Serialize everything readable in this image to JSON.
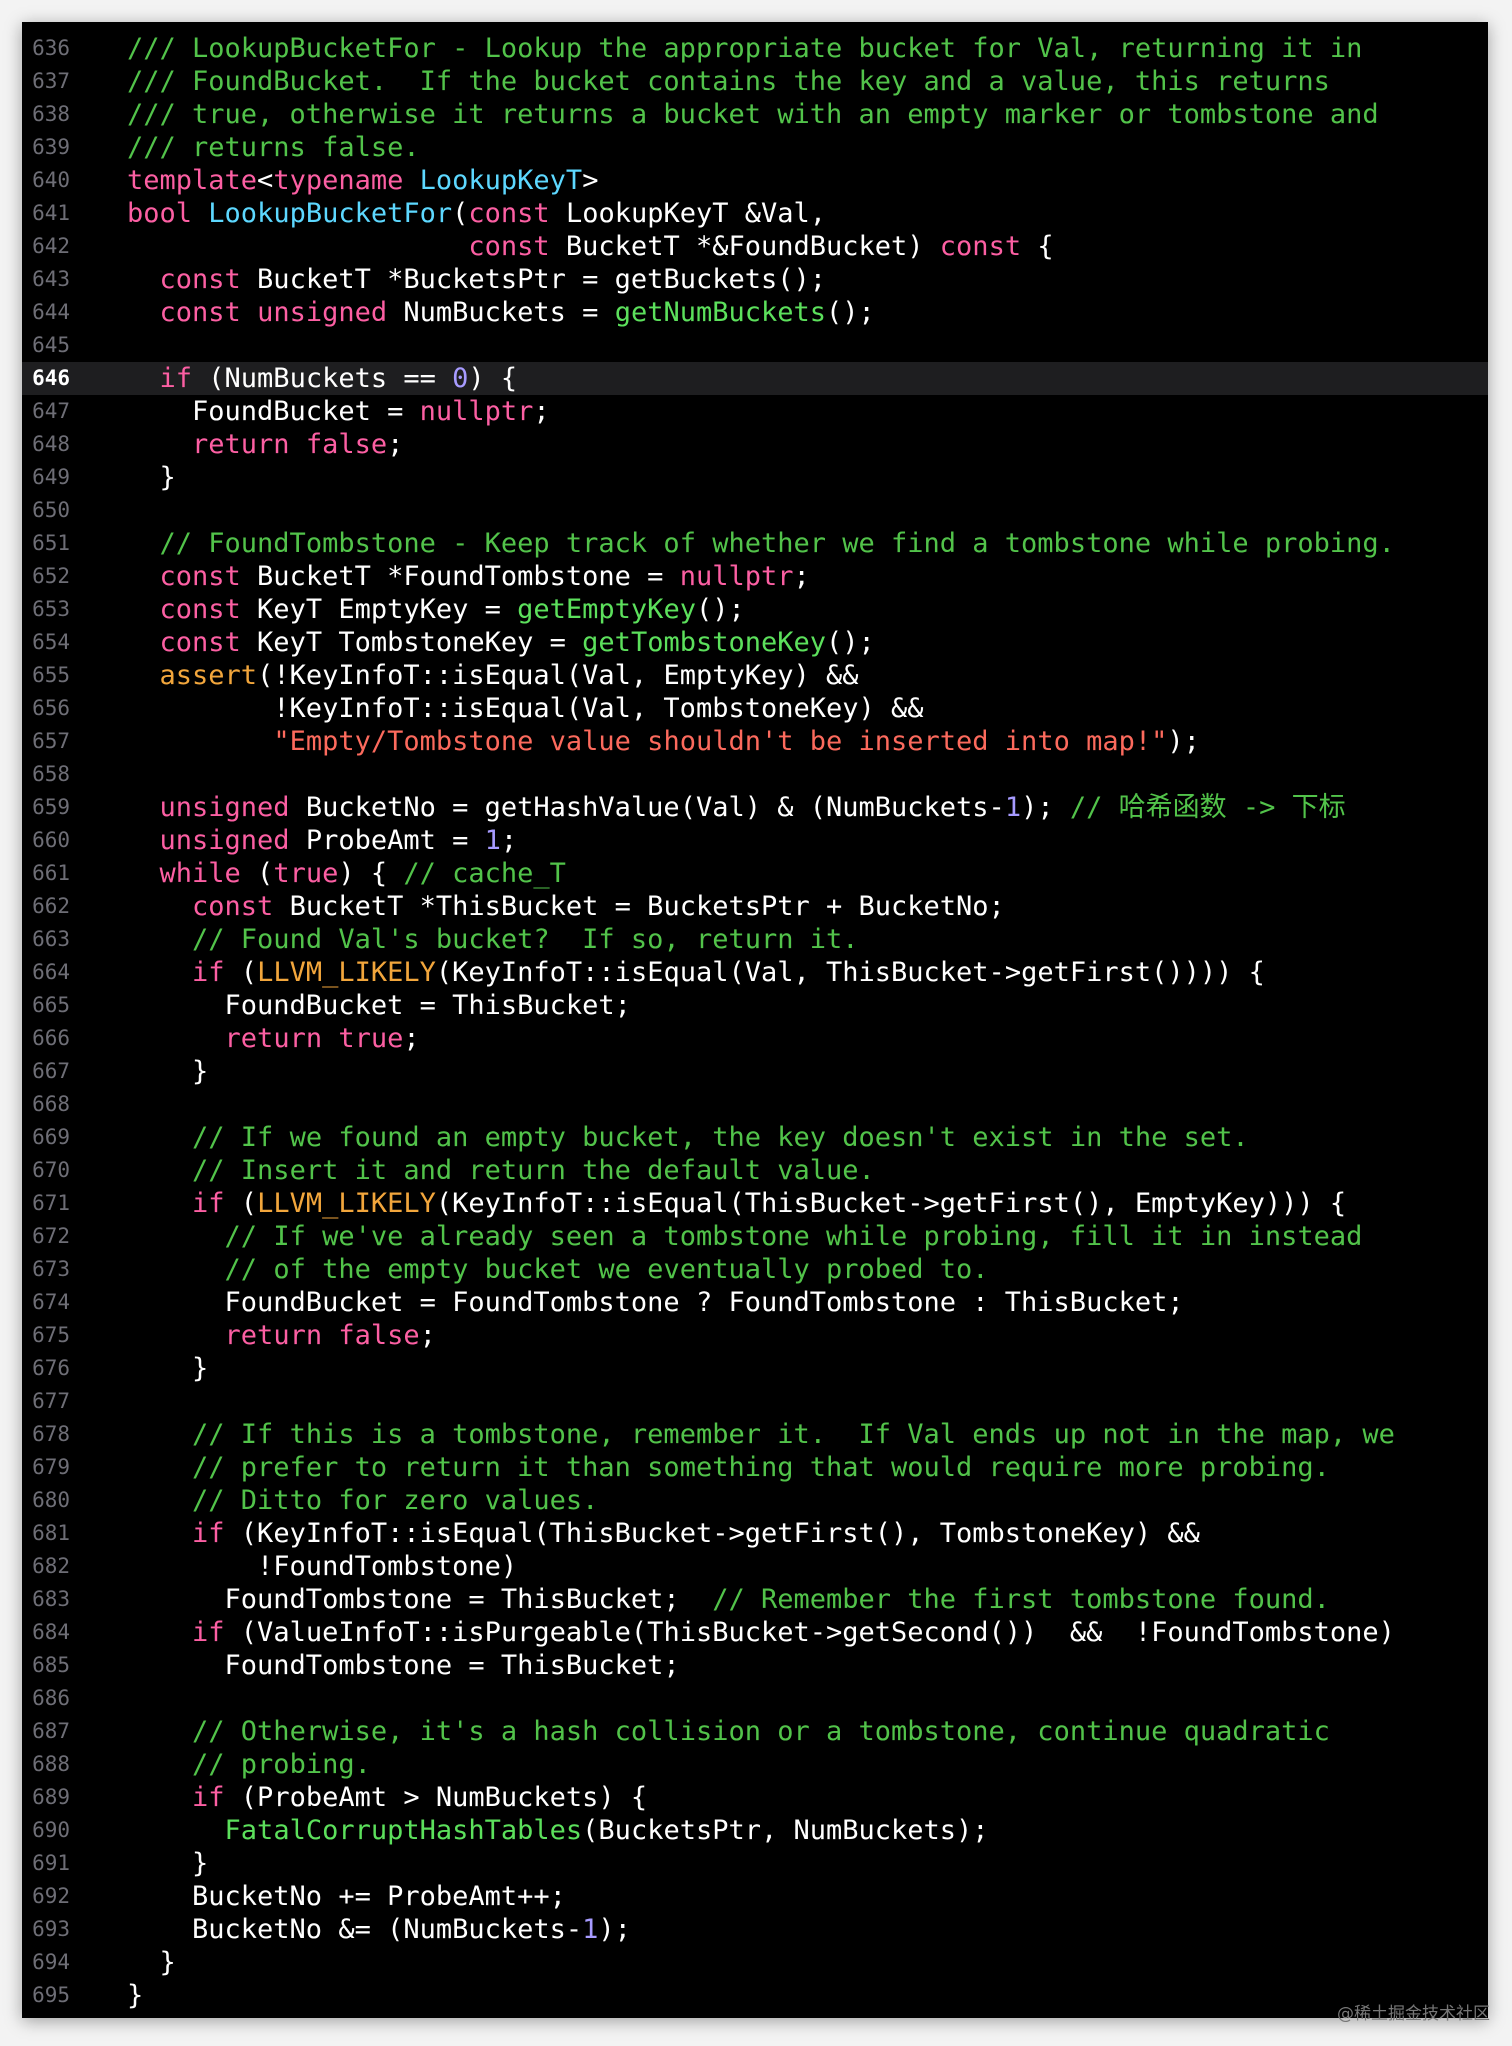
{
  "editor": {
    "highlighted_line": "646",
    "watermark": "@稀土掘金技术社区",
    "lines": [
      {
        "no": "636",
        "segs": [
          [
            "c",
            "/// LookupBucketFor - Lookup the appropriate bucket for Val, returning it in"
          ]
        ]
      },
      {
        "no": "637",
        "segs": [
          [
            "c",
            "/// FoundBucket.  If the bucket contains the key and a value, this returns"
          ]
        ]
      },
      {
        "no": "638",
        "segs": [
          [
            "c",
            "/// true, otherwise it returns a bucket with an empty marker or tombstone and"
          ]
        ]
      },
      {
        "no": "639",
        "segs": [
          [
            "c",
            "/// returns false."
          ]
        ]
      },
      {
        "no": "640",
        "segs": [
          [
            "k",
            "template"
          ],
          [
            "p",
            "<"
          ],
          [
            "k",
            "typename"
          ],
          [
            "p",
            " "
          ],
          [
            "t",
            "LookupKeyT"
          ],
          [
            "p",
            ">"
          ]
        ]
      },
      {
        "no": "641",
        "segs": [
          [
            "k",
            "bool"
          ],
          [
            "p",
            " "
          ],
          [
            "t",
            "LookupBucketFor"
          ],
          [
            "p",
            "("
          ],
          [
            "k",
            "const"
          ],
          [
            "p",
            " LookupKeyT &Val,"
          ]
        ]
      },
      {
        "no": "642",
        "segs": [
          [
            "p",
            "                     "
          ],
          [
            "k",
            "const"
          ],
          [
            "p",
            " BucketT *&FoundBucket) "
          ],
          [
            "k",
            "const"
          ],
          [
            "p",
            " {"
          ]
        ]
      },
      {
        "no": "643",
        "segs": [
          [
            "p",
            "  "
          ],
          [
            "k",
            "const"
          ],
          [
            "p",
            " BucketT *BucketsPtr = getBuckets();"
          ]
        ]
      },
      {
        "no": "644",
        "segs": [
          [
            "p",
            "  "
          ],
          [
            "k",
            "const"
          ],
          [
            "p",
            " "
          ],
          [
            "k",
            "unsigned"
          ],
          [
            "p",
            " NumBuckets = "
          ],
          [
            "f",
            "getNumBuckets"
          ],
          [
            "p",
            "();"
          ]
        ]
      },
      {
        "no": "645",
        "segs": []
      },
      {
        "no": "646",
        "segs": [
          [
            "p",
            "  "
          ],
          [
            "k",
            "if"
          ],
          [
            "p",
            " (NumBuckets == "
          ],
          [
            "n",
            "0"
          ],
          [
            "p",
            ") {"
          ]
        ]
      },
      {
        "no": "647",
        "segs": [
          [
            "p",
            "    FoundBucket = "
          ],
          [
            "k",
            "nullptr"
          ],
          [
            "p",
            ";"
          ]
        ]
      },
      {
        "no": "648",
        "segs": [
          [
            "p",
            "    "
          ],
          [
            "k",
            "return false"
          ],
          [
            "p",
            ";"
          ]
        ]
      },
      {
        "no": "649",
        "segs": [
          [
            "p",
            "  }"
          ]
        ]
      },
      {
        "no": "650",
        "segs": []
      },
      {
        "no": "651",
        "segs": [
          [
            "p",
            "  "
          ],
          [
            "c",
            "// FoundTombstone - Keep track of whether we find a tombstone while probing."
          ]
        ]
      },
      {
        "no": "652",
        "segs": [
          [
            "p",
            "  "
          ],
          [
            "k",
            "const"
          ],
          [
            "p",
            " BucketT *FoundTombstone = "
          ],
          [
            "k",
            "nullptr"
          ],
          [
            "p",
            ";"
          ]
        ]
      },
      {
        "no": "653",
        "segs": [
          [
            "p",
            "  "
          ],
          [
            "k",
            "const"
          ],
          [
            "p",
            " KeyT EmptyKey = "
          ],
          [
            "f",
            "getEmptyKey"
          ],
          [
            "p",
            "();"
          ]
        ]
      },
      {
        "no": "654",
        "segs": [
          [
            "p",
            "  "
          ],
          [
            "k",
            "const"
          ],
          [
            "p",
            " KeyT TombstoneKey = "
          ],
          [
            "f",
            "getTombstoneKey"
          ],
          [
            "p",
            "();"
          ]
        ]
      },
      {
        "no": "655",
        "segs": [
          [
            "p",
            "  "
          ],
          [
            "m",
            "assert"
          ],
          [
            "p",
            "(!KeyInfoT::isEqual(Val, EmptyKey) &&"
          ]
        ]
      },
      {
        "no": "656",
        "segs": [
          [
            "p",
            "         !KeyInfoT::isEqual(Val, TombstoneKey) &&"
          ]
        ]
      },
      {
        "no": "657",
        "segs": [
          [
            "p",
            "         "
          ],
          [
            "s",
            "\"Empty/Tombstone value shouldn't be inserted into map!\""
          ],
          [
            "p",
            ");"
          ]
        ]
      },
      {
        "no": "658",
        "segs": []
      },
      {
        "no": "659",
        "segs": [
          [
            "p",
            "  "
          ],
          [
            "k",
            "unsigned"
          ],
          [
            "p",
            " BucketNo = getHashValue(Val) & (NumBuckets-"
          ],
          [
            "n",
            "1"
          ],
          [
            "p",
            "); "
          ],
          [
            "c",
            "// 哈希函数 -> 下标"
          ]
        ]
      },
      {
        "no": "660",
        "segs": [
          [
            "p",
            "  "
          ],
          [
            "k",
            "unsigned"
          ],
          [
            "p",
            " ProbeAmt = "
          ],
          [
            "n",
            "1"
          ],
          [
            "p",
            ";"
          ]
        ]
      },
      {
        "no": "661",
        "segs": [
          [
            "p",
            "  "
          ],
          [
            "k",
            "while"
          ],
          [
            "p",
            " ("
          ],
          [
            "k",
            "true"
          ],
          [
            "p",
            ") { "
          ],
          [
            "c",
            "// cache_T"
          ]
        ]
      },
      {
        "no": "662",
        "segs": [
          [
            "p",
            "    "
          ],
          [
            "k",
            "const"
          ],
          [
            "p",
            " BucketT *ThisBucket = BucketsPtr + BucketNo;"
          ]
        ]
      },
      {
        "no": "663",
        "segs": [
          [
            "p",
            "    "
          ],
          [
            "c",
            "// Found Val's bucket?  If so, return it."
          ]
        ]
      },
      {
        "no": "664",
        "segs": [
          [
            "p",
            "    "
          ],
          [
            "k",
            "if"
          ],
          [
            "p",
            " ("
          ],
          [
            "m",
            "LLVM_LIKELY"
          ],
          [
            "p",
            "(KeyInfoT::isEqual(Val, ThisBucket->getFirst()))) {"
          ]
        ]
      },
      {
        "no": "665",
        "segs": [
          [
            "p",
            "      FoundBucket = ThisBucket;"
          ]
        ]
      },
      {
        "no": "666",
        "segs": [
          [
            "p",
            "      "
          ],
          [
            "k",
            "return true"
          ],
          [
            "p",
            ";"
          ]
        ]
      },
      {
        "no": "667",
        "segs": [
          [
            "p",
            "    }"
          ]
        ]
      },
      {
        "no": "668",
        "segs": []
      },
      {
        "no": "669",
        "segs": [
          [
            "p",
            "    "
          ],
          [
            "c",
            "// If we found an empty bucket, the key doesn't exist in the set."
          ]
        ]
      },
      {
        "no": "670",
        "segs": [
          [
            "p",
            "    "
          ],
          [
            "c",
            "// Insert it and return the default value."
          ]
        ]
      },
      {
        "no": "671",
        "segs": [
          [
            "p",
            "    "
          ],
          [
            "k",
            "if"
          ],
          [
            "p",
            " ("
          ],
          [
            "m",
            "LLVM_LIKELY"
          ],
          [
            "p",
            "(KeyInfoT::isEqual(ThisBucket->getFirst(), EmptyKey))) {"
          ]
        ]
      },
      {
        "no": "672",
        "segs": [
          [
            "p",
            "      "
          ],
          [
            "c",
            "// If we've already seen a tombstone while probing, fill it in instead"
          ]
        ]
      },
      {
        "no": "673",
        "segs": [
          [
            "p",
            "      "
          ],
          [
            "c",
            "// of the empty bucket we eventually probed to."
          ]
        ]
      },
      {
        "no": "674",
        "segs": [
          [
            "p",
            "      FoundBucket = FoundTombstone ? FoundTombstone : ThisBucket;"
          ]
        ]
      },
      {
        "no": "675",
        "segs": [
          [
            "p",
            "      "
          ],
          [
            "k",
            "return false"
          ],
          [
            "p",
            ";"
          ]
        ]
      },
      {
        "no": "676",
        "segs": [
          [
            "p",
            "    }"
          ]
        ]
      },
      {
        "no": "677",
        "segs": []
      },
      {
        "no": "678",
        "segs": [
          [
            "p",
            "    "
          ],
          [
            "c",
            "// If this is a tombstone, remember it.  If Val ends up not in the map, we"
          ]
        ]
      },
      {
        "no": "679",
        "segs": [
          [
            "p",
            "    "
          ],
          [
            "c",
            "// prefer to return it than something that would require more probing."
          ]
        ]
      },
      {
        "no": "680",
        "segs": [
          [
            "p",
            "    "
          ],
          [
            "c",
            "// Ditto for zero values."
          ]
        ]
      },
      {
        "no": "681",
        "segs": [
          [
            "p",
            "    "
          ],
          [
            "k",
            "if"
          ],
          [
            "p",
            " (KeyInfoT::isEqual(ThisBucket->getFirst(), TombstoneKey) &&"
          ]
        ]
      },
      {
        "no": "682",
        "segs": [
          [
            "p",
            "        !FoundTombstone)"
          ]
        ]
      },
      {
        "no": "683",
        "segs": [
          [
            "p",
            "      FoundTombstone = ThisBucket;  "
          ],
          [
            "c",
            "// Remember the first tombstone found."
          ]
        ]
      },
      {
        "no": "684",
        "segs": [
          [
            "p",
            "    "
          ],
          [
            "k",
            "if"
          ],
          [
            "p",
            " (ValueInfoT::isPurgeable(ThisBucket->getSecond())  &&  !FoundTombstone)"
          ]
        ]
      },
      {
        "no": "685",
        "segs": [
          [
            "p",
            "      FoundTombstone = ThisBucket;"
          ]
        ]
      },
      {
        "no": "686",
        "segs": []
      },
      {
        "no": "687",
        "segs": [
          [
            "p",
            "    "
          ],
          [
            "c",
            "// Otherwise, it's a hash collision or a tombstone, continue quadratic"
          ]
        ]
      },
      {
        "no": "688",
        "segs": [
          [
            "p",
            "    "
          ],
          [
            "c",
            "// probing."
          ]
        ]
      },
      {
        "no": "689",
        "segs": [
          [
            "p",
            "    "
          ],
          [
            "k",
            "if"
          ],
          [
            "p",
            " (ProbeAmt > NumBuckets) {"
          ]
        ]
      },
      {
        "no": "690",
        "segs": [
          [
            "p",
            "      "
          ],
          [
            "f",
            "FatalCorruptHashTables"
          ],
          [
            "p",
            "(BucketsPtr, NumBuckets);"
          ]
        ]
      },
      {
        "no": "691",
        "segs": [
          [
            "p",
            "    }"
          ]
        ]
      },
      {
        "no": "692",
        "segs": [
          [
            "p",
            "    BucketNo += ProbeAmt++;"
          ]
        ]
      },
      {
        "no": "693",
        "segs": [
          [
            "p",
            "    BucketNo &= (NumBuckets-"
          ],
          [
            "n",
            "1"
          ],
          [
            "p",
            ");"
          ]
        ]
      },
      {
        "no": "694",
        "segs": [
          [
            "p",
            "  }"
          ]
        ]
      },
      {
        "no": "695",
        "segs": [
          [
            "p",
            "}"
          ]
        ]
      }
    ]
  }
}
